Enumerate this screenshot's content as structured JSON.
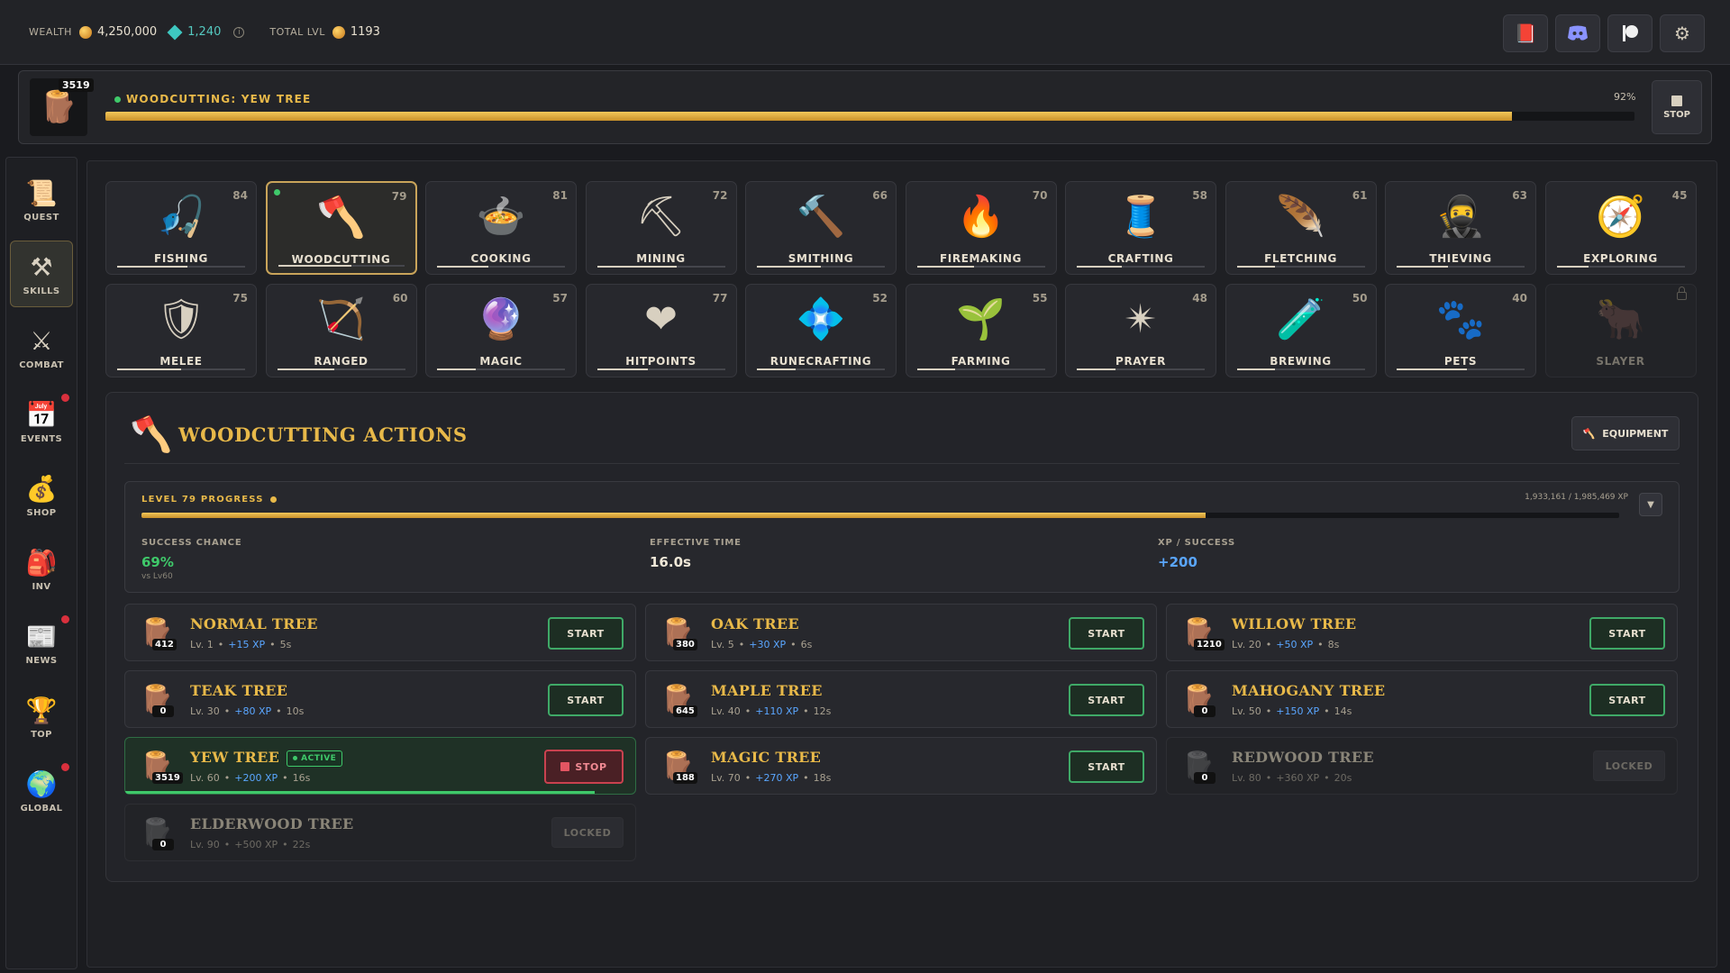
{
  "topbar": {
    "wealth_label": "WEALTH",
    "gold": "4,250,000",
    "gems": "1,240",
    "total_lvl_label": "TOTAL LVL",
    "total_lvl": "1193",
    "info_glyph": "i",
    "icons": [
      "book-icon",
      "discord-icon",
      "patreon-icon",
      "gear-icon"
    ]
  },
  "activity": {
    "count": "3519",
    "title": "WOODCUTTING: YEW TREE",
    "percent_text": "92%",
    "progress": 0.92,
    "stop_label": "STOP"
  },
  "sidebar": {
    "items": [
      {
        "label": "QUEST",
        "icon": "scroll-icon",
        "glyph": "📜",
        "notif": false,
        "active": false
      },
      {
        "label": "SKILLS",
        "icon": "tools-icon",
        "glyph": "⚒",
        "notif": false,
        "active": true
      },
      {
        "label": "COMBAT",
        "icon": "crossed-swords-icon",
        "glyph": "⚔",
        "notif": false,
        "active": false
      },
      {
        "label": "EVENTS",
        "icon": "calendar-icon",
        "glyph": "📅",
        "notif": true,
        "active": false
      },
      {
        "label": "SHOP",
        "icon": "pouch-icon",
        "glyph": "💰",
        "notif": false,
        "active": false
      },
      {
        "label": "INV",
        "icon": "backpack-icon",
        "glyph": "🎒",
        "notif": false,
        "active": false
      },
      {
        "label": "NEWS",
        "icon": "scroll-news-icon",
        "glyph": "📰",
        "notif": true,
        "active": false
      },
      {
        "label": "TOP",
        "icon": "trophy-icon",
        "glyph": "🏆",
        "notif": false,
        "active": false
      },
      {
        "label": "GLOBAL",
        "icon": "globe-icon",
        "glyph": "🌍",
        "notif": true,
        "active": false
      }
    ]
  },
  "skills": [
    {
      "name": "FISHING",
      "level": "84",
      "icon": "fishing-hook-icon",
      "glyph": "🎣",
      "progress": 0.55
    },
    {
      "name": "WOODCUTTING",
      "level": "79",
      "icon": "axe-stump-icon",
      "glyph": "🪓",
      "progress": 0.58,
      "active": true
    },
    {
      "name": "COOKING",
      "level": "81",
      "icon": "cooking-pot-icon",
      "glyph": "🍲",
      "progress": 0.4
    },
    {
      "name": "MINING",
      "level": "72",
      "icon": "pickaxe-icon",
      "glyph": "⛏",
      "progress": 0.62
    },
    {
      "name": "SMITHING",
      "level": "66",
      "icon": "anvil-icon",
      "glyph": "🔨",
      "progress": 0.5
    },
    {
      "name": "FIREMAKING",
      "level": "70",
      "icon": "campfire-icon",
      "glyph": "🔥",
      "progress": 0.45
    },
    {
      "name": "CRAFTING",
      "level": "58",
      "icon": "thread-spool-icon",
      "glyph": "🧵",
      "progress": 0.35
    },
    {
      "name": "FLETCHING",
      "level": "61",
      "icon": "feather-icon",
      "glyph": "🪶",
      "progress": 0.3
    },
    {
      "name": "THIEVING",
      "level": "63",
      "icon": "hooded-thief-icon",
      "glyph": "🥷",
      "progress": 0.4
    },
    {
      "name": "EXPLORING",
      "level": "45",
      "icon": "compass-icon",
      "glyph": "🧭",
      "progress": 0.25
    },
    {
      "name": "MELEE",
      "level": "75",
      "icon": "shield-sword-icon",
      "glyph": "🛡",
      "progress": 0.5
    },
    {
      "name": "RANGED",
      "level": "60",
      "icon": "bow-icon",
      "glyph": "🏹",
      "progress": 0.45
    },
    {
      "name": "MAGIC",
      "level": "57",
      "icon": "crystal-orb-icon",
      "glyph": "🔮",
      "progress": 0.3
    },
    {
      "name": "HITPOINTS",
      "level": "77",
      "icon": "heart-icon",
      "glyph": "❤",
      "progress": 0.4
    },
    {
      "name": "RUNECRAFTING",
      "level": "52",
      "icon": "rune-icon",
      "glyph": "💠",
      "progress": 0.3
    },
    {
      "name": "FARMING",
      "level": "55",
      "icon": "sprout-icon",
      "glyph": "🌱",
      "progress": 0.3
    },
    {
      "name": "PRAYER",
      "level": "48",
      "icon": "star-icon",
      "glyph": "✴",
      "progress": 0.3
    },
    {
      "name": "BREWING",
      "level": "50",
      "icon": "potion-icon",
      "glyph": "🧪",
      "progress": 0.3
    },
    {
      "name": "PETS",
      "level": "40",
      "icon": "paw-icon",
      "glyph": "🐾",
      "progress": 0.55
    },
    {
      "name": "SLAYER",
      "level": "",
      "icon": "bull-skull-icon",
      "glyph": "🐂",
      "progress": 0,
      "locked": true
    }
  ],
  "actions": {
    "title": "WOODCUTTING ACTIONS",
    "equipment_label": "EQUIPMENT",
    "progress_label": "LEVEL 79 PROGRESS",
    "xp_text": "1,933,161 / 1,985,469 XP",
    "level_progress": 0.72,
    "success_label": "SUCCESS CHANCE",
    "success_value": "69%",
    "success_sub": "vs Lv60",
    "time_label": "EFFECTIVE TIME",
    "time_value": "16.0s",
    "xp_label": "XP / SUCCESS",
    "xp_value": "+200"
  },
  "trees": [
    {
      "name": "NORMAL TREE",
      "count": "412",
      "lvl": "Lv. 1",
      "xp": "+15 XP",
      "time": "5s",
      "state": "start",
      "btn": "START",
      "icon": "log-icon",
      "glyph": "🪵"
    },
    {
      "name": "OAK TREE",
      "count": "380",
      "lvl": "Lv. 5",
      "xp": "+30 XP",
      "time": "6s",
      "state": "start",
      "btn": "START",
      "icon": "log-icon",
      "glyph": "🪵"
    },
    {
      "name": "WILLOW TREE",
      "count": "1210",
      "lvl": "Lv. 20",
      "xp": "+50 XP",
      "time": "8s",
      "state": "start",
      "btn": "START",
      "icon": "log-icon",
      "glyph": "🪵"
    },
    {
      "name": "TEAK TREE",
      "count": "0",
      "lvl": "Lv. 30",
      "xp": "+80 XP",
      "time": "10s",
      "state": "start",
      "btn": "START",
      "icon": "log-icon",
      "glyph": "🪵"
    },
    {
      "name": "MAPLE TREE",
      "count": "645",
      "lvl": "Lv. 40",
      "xp": "+110 XP",
      "time": "12s",
      "state": "start",
      "btn": "START",
      "icon": "log-icon",
      "glyph": "🪵"
    },
    {
      "name": "MAHOGANY TREE",
      "count": "0",
      "lvl": "Lv. 50",
      "xp": "+150 XP",
      "time": "14s",
      "state": "start",
      "btn": "START",
      "icon": "log-icon",
      "glyph": "🪵"
    },
    {
      "name": "YEW TREE",
      "count": "3519",
      "lvl": "Lv. 60",
      "xp": "+200 XP",
      "time": "16s",
      "state": "active",
      "btn": "STOP",
      "active_label": "ACTIVE",
      "progress": 0.92,
      "icon": "log-icon",
      "glyph": "🪵"
    },
    {
      "name": "MAGIC TREE",
      "count": "188",
      "lvl": "Lv. 70",
      "xp": "+270 XP",
      "time": "18s",
      "state": "start",
      "btn": "START",
      "icon": "magic-log-icon",
      "glyph": "🪵"
    },
    {
      "name": "REDWOOD TREE",
      "count": "0",
      "lvl": "Lv. 80",
      "xp": "+360 XP",
      "time": "20s",
      "state": "locked",
      "btn": "LOCKED",
      "icon": "log-icon",
      "glyph": "🪵"
    },
    {
      "name": "ELDERWOOD TREE",
      "count": "0",
      "lvl": "Lv. 90",
      "xp": "+500 XP",
      "time": "22s",
      "state": "locked",
      "btn": "LOCKED",
      "icon": "log-icon",
      "glyph": "🪵"
    }
  ],
  "meta_separator": "•",
  "colors": {
    "gold_accent": "#e8b949",
    "green_accent": "#3fc96a",
    "blue_xp": "#5aa6ff",
    "red_stop": "#c9424f"
  }
}
